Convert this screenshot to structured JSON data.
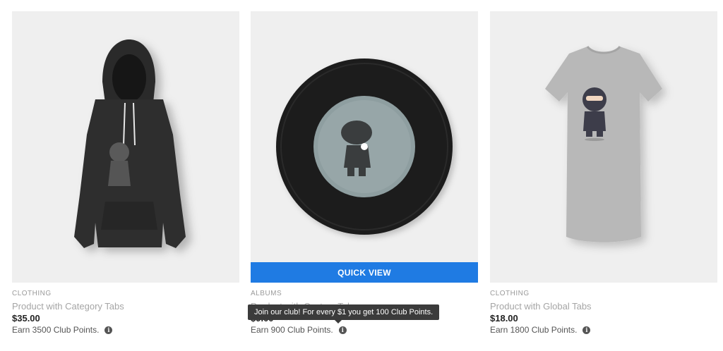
{
  "products": [
    {
      "category": "CLOTHING",
      "title": "Product with Category Tabs",
      "price": "$35.00",
      "points": "Earn 3500 Club Points."
    },
    {
      "category": "ALBUMS",
      "title": "Product with Custom Tabs",
      "price": "$9.00",
      "points": "Earn 900 Club Points.",
      "quick_view": "QUICK VIEW"
    },
    {
      "category": "CLOTHING",
      "title": "Product with Global Tabs",
      "price": "$18.00",
      "points": "Earn 1800 Club Points."
    }
  ],
  "tooltip": {
    "text": "Join our club! For every $1 you get 100 Club Points."
  },
  "icons": {
    "info": "info-icon",
    "info_glyph": "i"
  },
  "colors": {
    "quick_view_bg": "#1f7be3",
    "card_bg": "#efefef",
    "tooltip_bg": "#3b3b3b"
  }
}
